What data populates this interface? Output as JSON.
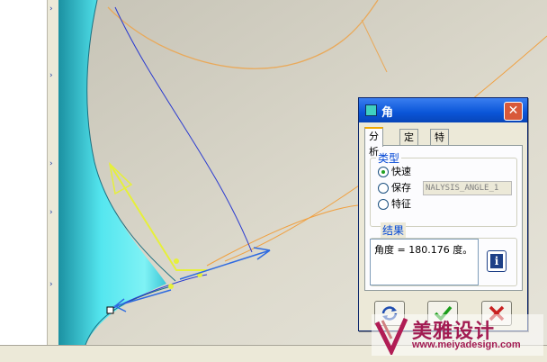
{
  "dialog": {
    "title": "角",
    "tabs": [
      {
        "label": "分析",
        "active": true
      },
      {
        "label": "定义",
        "active": false
      },
      {
        "label": "特征",
        "active": false
      }
    ],
    "type_group": {
      "label": "类型",
      "options": [
        {
          "label": "快速",
          "checked": true
        },
        {
          "label": "保存",
          "checked": false
        },
        {
          "label": "特征",
          "checked": false
        }
      ],
      "save_name_value": "NALYSIS_ANGLE_1"
    },
    "result_group": {
      "label": "结果",
      "text": "角度 = 180.176 度。"
    }
  },
  "watermark": {
    "text": "美雅设计",
    "url": "www.meiyadesign.com"
  },
  "colors": {
    "titlebar": "#0a55d8",
    "surface_cyan": "#4fe0ea",
    "curve_blue": "#2a3ad0",
    "curve_orange": "#f0a040",
    "vector_yellow": "#e8f040"
  }
}
